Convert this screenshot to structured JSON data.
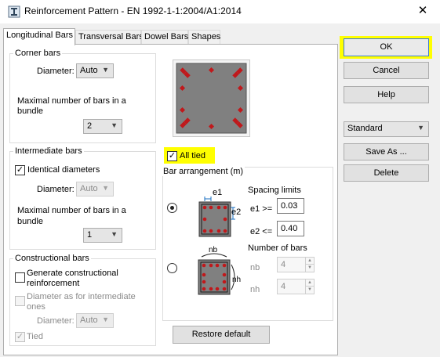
{
  "window": {
    "title": "Reinforcement Pattern - EN 1992-1-1:2004/A1:2014",
    "close_icon": "close-icon"
  },
  "tabs": [
    "Longitudinal Bars",
    "Transversal Bars",
    "Dowel Bars",
    "Shapes"
  ],
  "corner_bars": {
    "title": "Corner bars",
    "diameter_label": "Diameter:",
    "diameter_value": "Auto",
    "max_bars_label_line1": "Maximal number of bars in a",
    "max_bars_label_line2": "bundle",
    "max_bars_value": "2"
  },
  "intermediate_bars": {
    "title": "Intermediate bars",
    "identical_label": "Identical diameters",
    "identical_checked": true,
    "diameter_label": "Diameter:",
    "diameter_value": "Auto",
    "max_bars_label_line1": "Maximal number of bars in a",
    "max_bars_label_line2": "bundle",
    "max_bars_value": "1"
  },
  "constructional_bars": {
    "title": "Constructional bars",
    "generate_label_line1": "Generate constructional",
    "generate_label_line2": "reinforcement",
    "generate_checked": false,
    "diameter_as_label_line1": "Diameter as for intermediate",
    "diameter_as_label_line2": "ones",
    "diameter_label": "Diameter:",
    "diameter_value": "Auto",
    "tied_label": "Tied",
    "tied_checked": true
  },
  "all_tied": {
    "label": "All tied",
    "checked": true,
    "highlight": "#ffff00"
  },
  "bar_arrangement": {
    "title": "Bar arrangement (m)",
    "option1_selected": true,
    "spacing_limits_label": "Spacing limits",
    "e1_label": "e1 >=",
    "e1_value": "0.03",
    "e2_label": "e2 <=",
    "e2_value": "0.40",
    "diagram1_e1": "e1",
    "diagram1_e2": "e2",
    "number_of_bars_label": "Number of bars",
    "nb_label": "nb",
    "nb_value": "4",
    "nh_label": "nh",
    "nh_value": "4",
    "diagram2_nb": "nb",
    "diagram2_nh": "nh"
  },
  "buttons": {
    "ok": "OK",
    "cancel": "Cancel",
    "help": "Help",
    "preset": "Standard",
    "save_as": "Save As ...",
    "delete": "Delete",
    "restore_default": "Restore default"
  },
  "colors": {
    "highlight": "#ffff00",
    "section_fill": "#808080",
    "bar_color": "#c0181b"
  }
}
